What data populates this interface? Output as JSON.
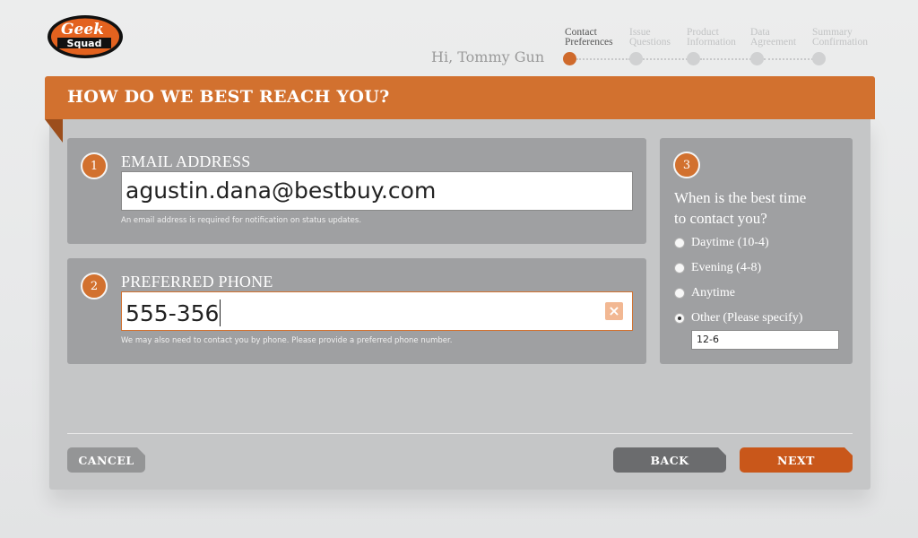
{
  "header": {
    "logo_text": [
      "Geek",
      "Squad"
    ],
    "greeting": "Hi, Tommy Gun",
    "steps": [
      {
        "label1": "Contact",
        "label2": "Preferences",
        "active": true
      },
      {
        "label1": "Issue",
        "label2": "Questions",
        "active": false
      },
      {
        "label1": "Product",
        "label2": "Information",
        "active": false
      },
      {
        "label1": "Data",
        "label2": "Agreement",
        "active": false
      },
      {
        "label1": "Summary",
        "label2": "Confirmation",
        "active": false
      }
    ]
  },
  "form": {
    "title": "HOW DO WE BEST REACH YOU?",
    "email": {
      "number": "1",
      "label": "EMAIL ADDRESS",
      "value": "agustin.dana@bestbuy.com",
      "hint": "An email address is required for notification on status updates."
    },
    "phone": {
      "number": "2",
      "label": "PREFERRED PHONE",
      "value": "555-356",
      "clear_icon": "close-icon",
      "hint": "We may also need to contact you by phone. Please provide a preferred phone number."
    },
    "contact_time": {
      "number": "3",
      "question_line1": "When is the best time",
      "question_line2": "to contact you?",
      "options": [
        {
          "label": "Daytime (10-4)",
          "checked": false
        },
        {
          "label": "Evening (4-8)",
          "checked": false
        },
        {
          "label": "Anytime",
          "checked": false
        },
        {
          "label": "Other (Please specify)",
          "checked": true
        }
      ],
      "other_value": "12-6"
    }
  },
  "buttons": {
    "cancel": "CANCEL",
    "back": "BACK",
    "next": "NEXT"
  },
  "colors": {
    "accent": "#d2712f",
    "panel": "#9fa0a2",
    "card": "#c5c6c7"
  }
}
